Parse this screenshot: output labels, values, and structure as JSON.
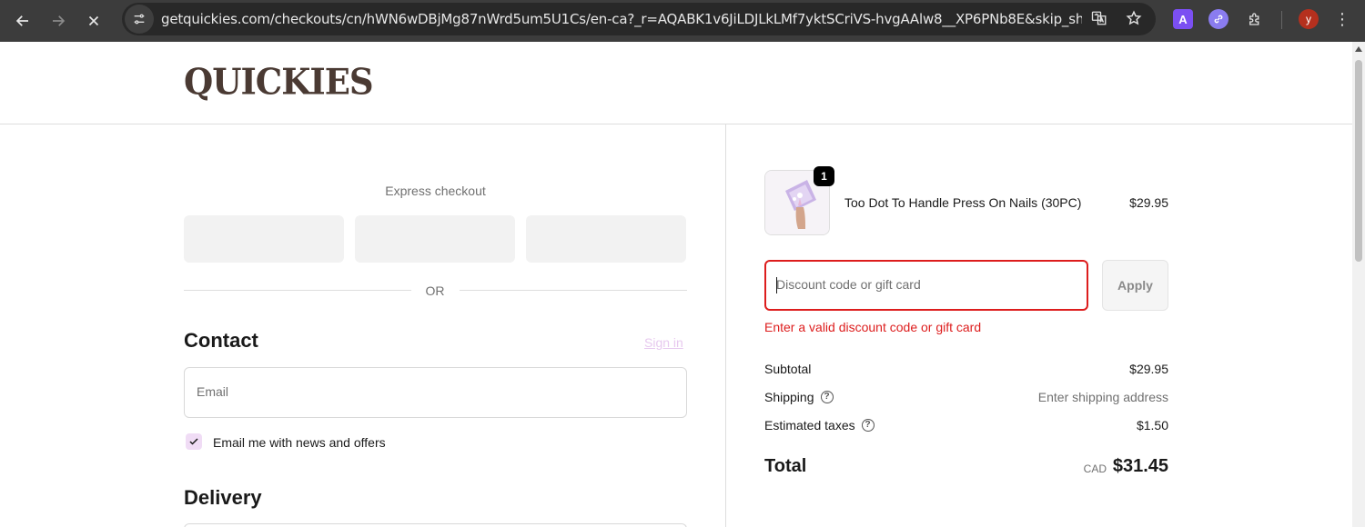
{
  "browser": {
    "url": "getquickies.com/checkouts/cn/hWN6wDBjMg87nWrd5um5U1Cs/en-ca?_r=AQABK1v6JiLDJLkLMf7yktSCriVS-hvgAAlw8__XP6PNb8E&skip_shop_pay...",
    "avatar_letter": "y",
    "ext_a_letter": "A"
  },
  "header": {
    "logo_text": "QUICKIES"
  },
  "express": {
    "title": "Express checkout",
    "or_label": "OR"
  },
  "contact": {
    "heading": "Contact",
    "signin_label": "Sign in",
    "email_placeholder": "Email",
    "newsletter_label": "Email me with news and offers",
    "newsletter_checked": true
  },
  "delivery": {
    "heading": "Delivery"
  },
  "order": {
    "item_name": "Too Dot To Handle Press On Nails (30PC)",
    "item_price": "$29.95",
    "item_qty": "1",
    "discount_placeholder": "Discount code or gift card",
    "apply_label": "Apply",
    "error_text": "Enter a valid discount code or gift card",
    "subtotal_label": "Subtotal",
    "subtotal_value": "$29.95",
    "shipping_label": "Shipping",
    "shipping_value": "Enter shipping address",
    "taxes_label": "Estimated taxes",
    "taxes_value": "$1.50",
    "total_label": "Total",
    "total_currency": "CAD",
    "total_value": "$31.45"
  },
  "colors": {
    "error": "#dd1d1d",
    "accent_light": "#f0dcf5",
    "logo": "#4a3a33"
  }
}
